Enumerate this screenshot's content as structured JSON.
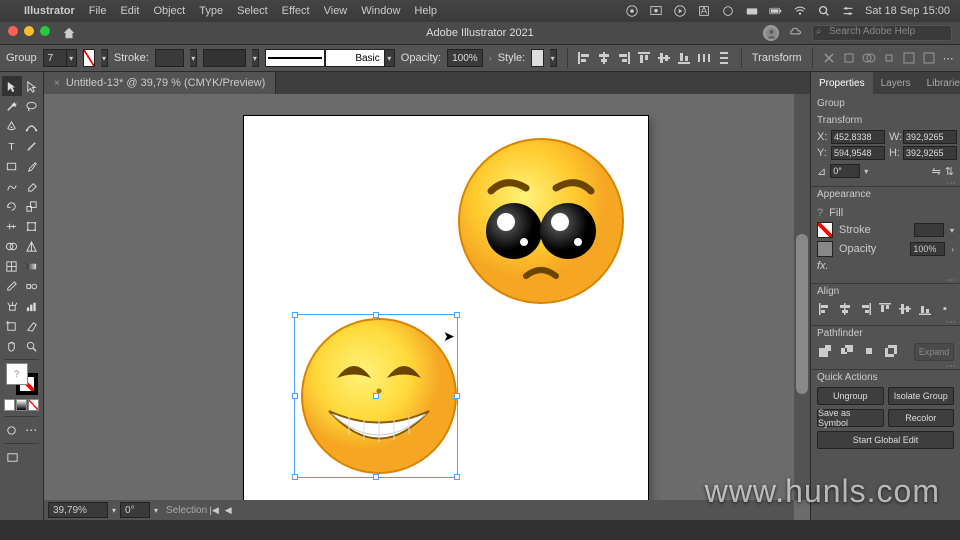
{
  "menubar": {
    "app": "Illustrator",
    "items": [
      "File",
      "Edit",
      "Object",
      "Type",
      "Select",
      "Effect",
      "View",
      "Window",
      "Help"
    ],
    "clock": "Sat 18 Sep  15:00"
  },
  "titlebar": {
    "title": "Adobe Illustrator 2021",
    "search_ph": "Search Adobe Help"
  },
  "controlbar": {
    "selection_type": "Group",
    "stroke_lbl": "Stroke:",
    "stroke_weight": "",
    "basic_lbl": "Basic",
    "opacity_lbl": "Opacity:",
    "opacity_val": "100%",
    "style_lbl": "Style:",
    "transform_lbl": "Transform",
    "fill_pt": "7"
  },
  "doc_tab": {
    "label": "Untitled-13* @ 39,79 % (CMYK/Preview)"
  },
  "statusbar": {
    "zoom": "39,79%",
    "rot": "0°",
    "mode": "Selection"
  },
  "properties": {
    "tabs": [
      "Properties",
      "Layers",
      "Libraries"
    ],
    "sel_label": "Group",
    "transform_hdr": "Transform",
    "x_lbl": "X:",
    "y_lbl": "Y:",
    "w_lbl": "W:",
    "h_lbl": "H:",
    "x": "452,8338",
    "y": "594,9548",
    "w": "392,9265",
    "h": "392,9265",
    "angle": "0°",
    "appearance_hdr": "Appearance",
    "fill_lbl": "Fill",
    "stroke_lbl": "Stroke",
    "opacity_lbl": "Opacity",
    "opacity_val": "100%",
    "fx_lbl": "fx.",
    "align_hdr": "Align",
    "pathfinder_hdr": "Pathfinder",
    "expand_btn": "Expand",
    "qa_hdr": "Quick Actions",
    "ungroup": "Ungroup",
    "isolate": "Isolate Group",
    "save_symbol": "Save as Symbol",
    "recolor": "Recolor",
    "global_edit": "Start Global Edit"
  },
  "watermark": "www.hunls.com"
}
